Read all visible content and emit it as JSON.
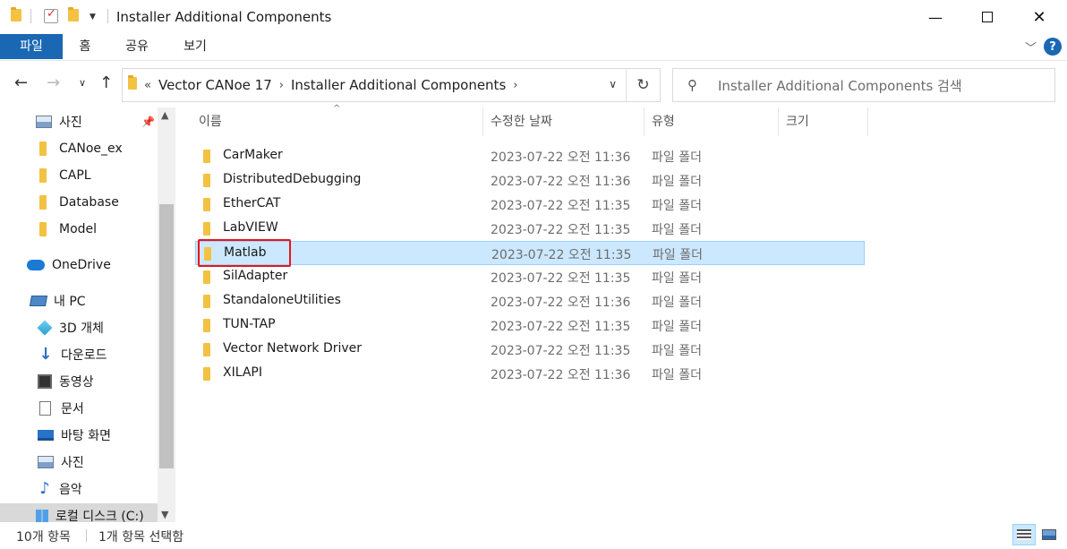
{
  "window": {
    "title": "Installer Additional Components",
    "minimize_icon": "minimize-icon",
    "maximize_icon": "maximize-icon",
    "close_icon": "close-icon"
  },
  "ribbon": {
    "tabs": [
      {
        "label": "파일",
        "active": true
      },
      {
        "label": "홈",
        "active": false
      },
      {
        "label": "공유",
        "active": false
      },
      {
        "label": "보기",
        "active": false
      }
    ],
    "help_label": "?"
  },
  "address": {
    "breadcrumbs": [
      "Vector CANoe 17",
      "Installer Additional Components"
    ],
    "overflow": "«",
    "search_placeholder": "Installer Additional Components 검색"
  },
  "sidebar": {
    "items": [
      {
        "label": "사진",
        "icon": "pictures-icon",
        "pinned": true
      },
      {
        "label": "CANoe_ex",
        "icon": "folder-icon"
      },
      {
        "label": "CAPL",
        "icon": "folder-icon"
      },
      {
        "label": "Database",
        "icon": "folder-icon"
      },
      {
        "label": "Model",
        "icon": "folder-icon"
      },
      {
        "label": "OneDrive",
        "icon": "onedrive-icon"
      },
      {
        "label": "내 PC",
        "icon": "pc-icon"
      },
      {
        "label": "3D 개체",
        "icon": "3d-objects-icon"
      },
      {
        "label": "다운로드",
        "icon": "download-icon"
      },
      {
        "label": "동영상",
        "icon": "video-icon"
      },
      {
        "label": "문서",
        "icon": "document-icon"
      },
      {
        "label": "바탕 화면",
        "icon": "desktop-icon"
      },
      {
        "label": "사진",
        "icon": "pictures-icon"
      },
      {
        "label": "음악",
        "icon": "music-icon"
      },
      {
        "label": "로컬 디스크 (C:)",
        "icon": "local-disk-icon"
      }
    ]
  },
  "columns": {
    "name": "이름",
    "date": "수정한 날짜",
    "type": "유형",
    "size": "크기"
  },
  "files": [
    {
      "name": "CarMaker",
      "date": "2023-07-22 오전 11:36",
      "type": "파일 폴더"
    },
    {
      "name": "DistributedDebugging",
      "date": "2023-07-22 오전 11:36",
      "type": "파일 폴더"
    },
    {
      "name": "EtherCAT",
      "date": "2023-07-22 오전 11:35",
      "type": "파일 폴더"
    },
    {
      "name": "LabVIEW",
      "date": "2023-07-22 오전 11:35",
      "type": "파일 폴더"
    },
    {
      "name": "Matlab",
      "date": "2023-07-22 오전 11:35",
      "type": "파일 폴더",
      "selected": true
    },
    {
      "name": "SilAdapter",
      "date": "2023-07-22 오전 11:35",
      "type": "파일 폴더"
    },
    {
      "name": "StandaloneUtilities",
      "date": "2023-07-22 오전 11:36",
      "type": "파일 폴더"
    },
    {
      "name": "TUN-TAP",
      "date": "2023-07-22 오전 11:35",
      "type": "파일 폴더"
    },
    {
      "name": "Vector Network Driver",
      "date": "2023-07-22 오전 11:35",
      "type": "파일 폴더"
    },
    {
      "name": "XILAPI",
      "date": "2023-07-22 오전 11:36",
      "type": "파일 폴더"
    }
  ],
  "status": {
    "item_count": "10개 항목",
    "selected_count": "1개 항목 선택함"
  },
  "colors": {
    "accent": "#1a67b4",
    "selection_bg": "#cce8ff",
    "highlight_border": "#e8141b",
    "folder": "#f3c242"
  }
}
